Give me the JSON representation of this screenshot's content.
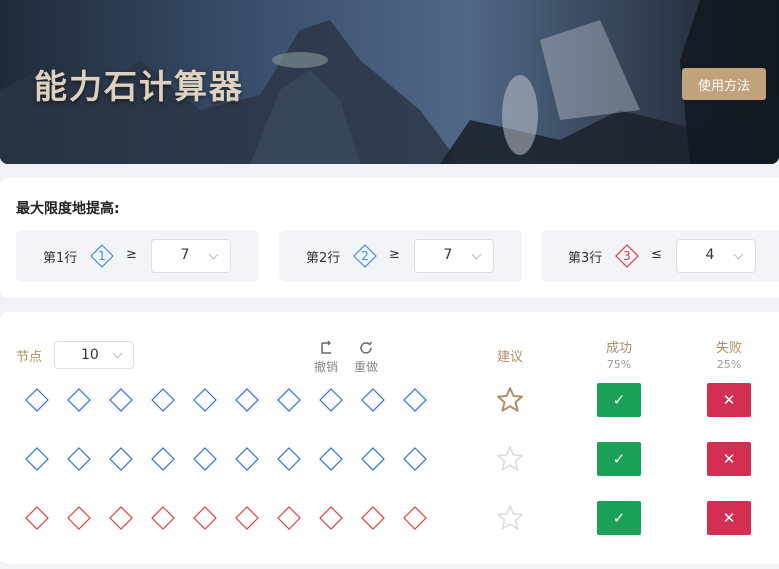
{
  "banner": {
    "title": "能力石计算器",
    "usage_button": "使用方法"
  },
  "settings": {
    "title": "最大限度地提高:",
    "rows": [
      {
        "label": "第1行",
        "badge": "1",
        "badge_color": "#3d8ee6",
        "operator": "≥",
        "value": "7"
      },
      {
        "label": "第2行",
        "badge": "2",
        "badge_color": "#3d8ee6",
        "operator": "≥",
        "value": "7"
      },
      {
        "label": "第3行",
        "badge": "3",
        "badge_color": "#e0384f",
        "operator": "≤",
        "value": "4"
      }
    ]
  },
  "board": {
    "nodes_label": "节点",
    "nodes_value": "10",
    "undo_label": "撤销",
    "redo_label": "重做",
    "suggest_label": "建议",
    "success_label": "成功",
    "success_rate": "75%",
    "fail_label": "失败",
    "fail_rate": "25%",
    "rows": [
      {
        "color": "#2f6fd8",
        "star": "suggested"
      },
      {
        "color": "#2f6fd8",
        "star": "inactive"
      },
      {
        "color": "#dc4040",
        "star": "inactive"
      }
    ],
    "ok_symbol": "✓",
    "fail_symbol": "✕"
  },
  "colors": {
    "accent_gold": "#c1a27a",
    "success": "#1aa157",
    "danger": "#d22f52"
  }
}
